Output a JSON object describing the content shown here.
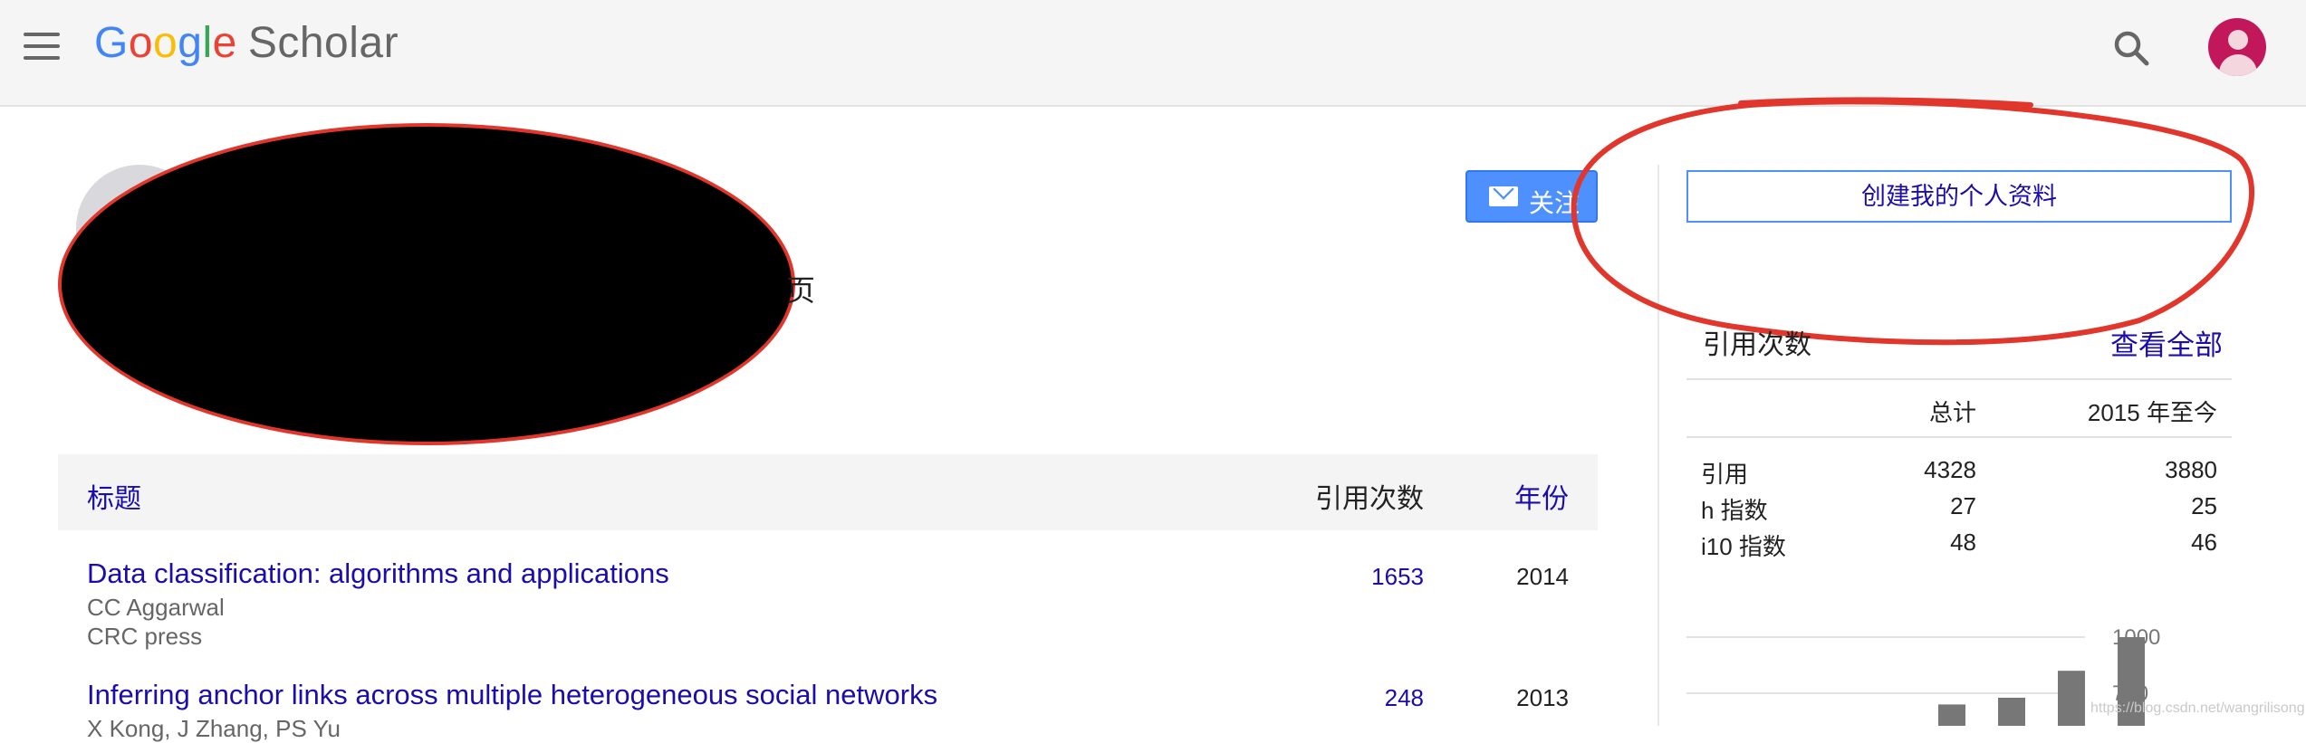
{
  "header": {
    "logo_google": "Google",
    "logo_product": "Scholar",
    "icons": [
      "menu-icon",
      "search-icon",
      "account-avatar-icon"
    ]
  },
  "profile": {
    "stray_char": "页",
    "follow_label": "关注",
    "create_profile_label": "创建我的个人资料"
  },
  "publications": {
    "headers": {
      "title": "标题",
      "cited_by": "引用次数",
      "year": "年份"
    },
    "rows": [
      {
        "title": "Data classification: algorithms and applications",
        "authors": "CC Aggarwal",
        "venue": "CRC press",
        "cites": "1653",
        "year": "2014"
      },
      {
        "title": "Inferring anchor links across multiple heterogeneous social networks",
        "authors": "X Kong, J Zhang, PS Yu",
        "venue": "",
        "cites": "248",
        "year": "2013"
      }
    ]
  },
  "citations": {
    "heading": "引用次数",
    "view_all": "查看全部",
    "col_total": "总计",
    "col_since": "2015 年至今",
    "rows": [
      {
        "label": "引用",
        "total": "4328",
        "since": "3880"
      },
      {
        "label": "h 指数",
        "total": "27",
        "since": "25"
      },
      {
        "label": "i10 指数",
        "total": "48",
        "since": "46"
      }
    ]
  },
  "chart_data": {
    "type": "bar",
    "ytick_labels": [
      "1000",
      "750"
    ],
    "ylim_visible": [
      700,
      1000
    ],
    "values": [
      700,
      730,
      850,
      1000
    ],
    "bar_color": "#777777"
  },
  "watermark": "https://blog.csdn.net/wangrilisong",
  "colors": {
    "link": "#1a0dab",
    "accent": "#4d90fe",
    "annotation": "#e0362c"
  }
}
